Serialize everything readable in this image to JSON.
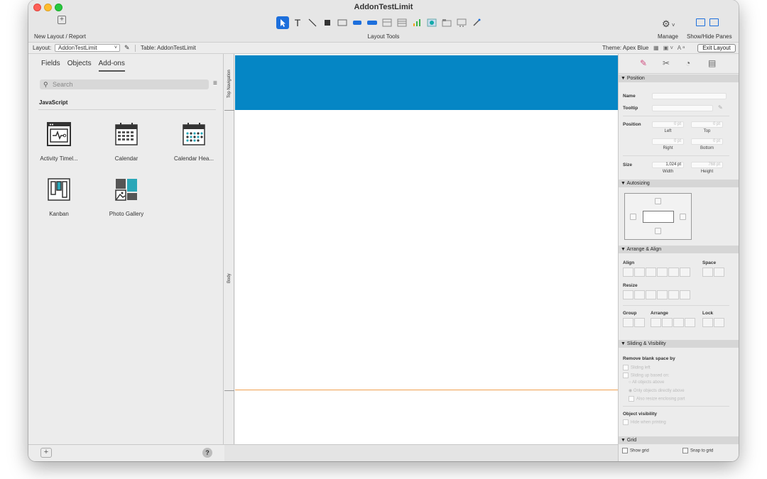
{
  "window": {
    "title": "AddonTestLimit"
  },
  "toolbar": {
    "new_layout_label": "New Layout / Report",
    "layout_tools_label": "Layout Tools",
    "manage_label": "Manage",
    "show_hide_label": "Show/Hide Panes",
    "tools": [
      "pointer-tool",
      "text-tool",
      "line-tool",
      "rectangle-tool",
      "field-tool",
      "button-tool",
      "button-bar-tool",
      "portal-tool",
      "popover-tool",
      "chart-tool",
      "web-viewer-tool",
      "tab-control-tool",
      "slide-control-tool",
      "format-painter-tool"
    ]
  },
  "layoutbar": {
    "layout_label": "Layout:",
    "layout_value": "AddonTestLimit",
    "table_label": "Table: AddonTestLimit",
    "theme_label": "Theme: Apex Blue",
    "exit_label": "Exit Layout"
  },
  "left_panel": {
    "tabs": [
      {
        "label": "Fields"
      },
      {
        "label": "Objects"
      },
      {
        "label": "Add-ons"
      }
    ],
    "active_tab": "Add-ons",
    "search_placeholder": "Search",
    "section_label": "JavaScript",
    "addons": [
      {
        "label": "Activity Timel...",
        "icon": "activity-timeline-icon"
      },
      {
        "label": "Calendar",
        "icon": "calendar-icon"
      },
      {
        "label": "Calendar Hea...",
        "icon": "calendar-heatmap-icon"
      },
      {
        "label": "Kanban",
        "icon": "kanban-icon"
      },
      {
        "label": "Photo Gallery",
        "icon": "photo-gallery-icon"
      }
    ],
    "help_label": "?"
  },
  "canvas": {
    "parts": [
      {
        "label": "Top Navigation"
      },
      {
        "label": "Body"
      }
    ],
    "nav_color": "#0586c5"
  },
  "inspector": {
    "tabs": [
      "position-tab-icon",
      "styles-tab-icon",
      "appearance-tab-icon",
      "data-tab-icon"
    ],
    "position": {
      "header": "▼ Position",
      "name_label": "Name",
      "tooltip_label": "Tooltip",
      "position_label": "Position",
      "left_value": "0 pt",
      "left_label": "Left",
      "top_value": "0 pt",
      "top_label": "Top",
      "right_value": "0 pt",
      "right_label": "Right",
      "bottom_value": "0 pt",
      "bottom_label": "Bottom",
      "size_label": "Size",
      "width_value": "1,024 pt",
      "width_label": "Width",
      "height_value": "768 pt",
      "height_label": "Height"
    },
    "autosizing": {
      "header": "▼ Autosizing"
    },
    "arrange": {
      "header": "▼ Arrange & Align",
      "align_label": "Align",
      "space_label": "Space",
      "resize_label": "Resize",
      "group_label": "Group",
      "arrange_label": "Arrange",
      "lock_label": "Lock"
    },
    "sliding": {
      "header": "▼ Sliding & Visibility",
      "remove_label": "Remove blank space by",
      "sliding_left": "Sliding left",
      "sliding_up": "Sliding up based on:",
      "all_above": "All objects above",
      "only_above": "Only objects directly above",
      "also_resize": "Also resize enclosing part",
      "visibility_label": "Object visibility",
      "hide_printing": "Hide when printing"
    },
    "grid": {
      "header": "▼ Grid",
      "show_grid": "Show grid",
      "snap_grid": "Snap to grid"
    }
  }
}
